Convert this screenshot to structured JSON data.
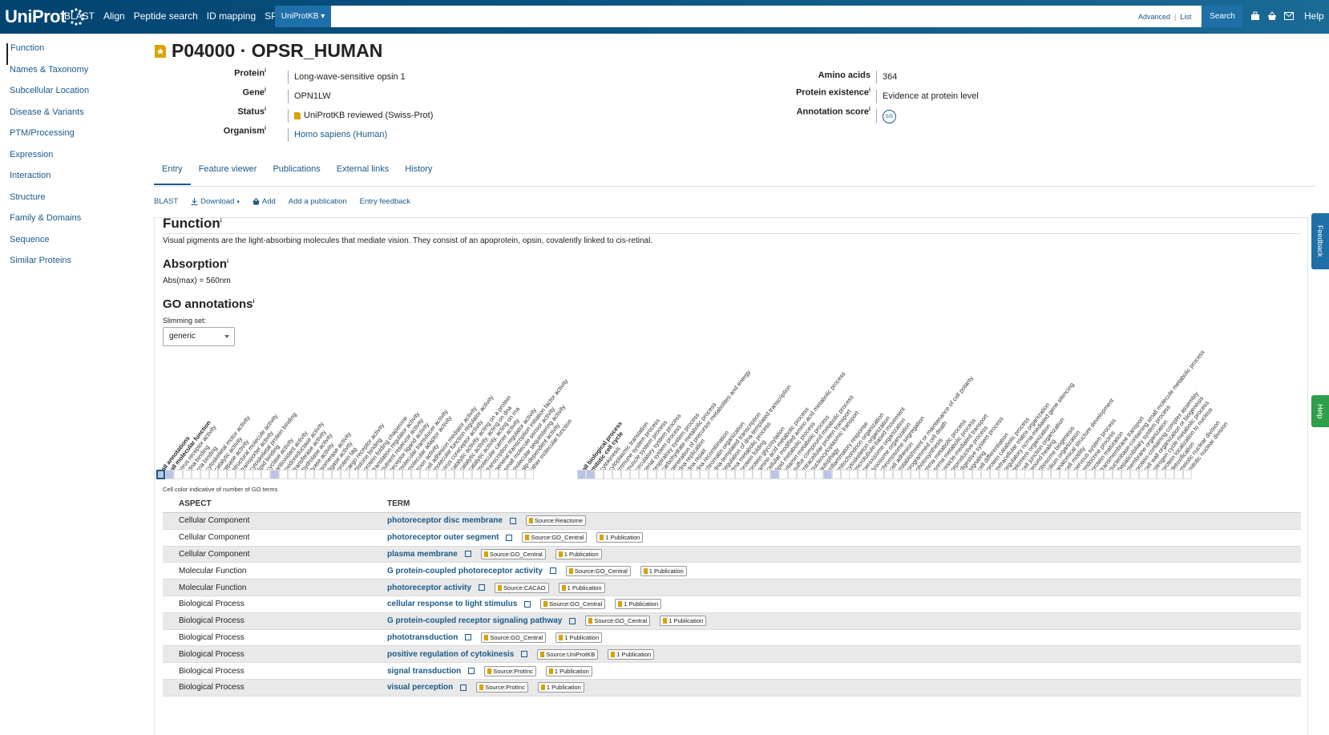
{
  "header": {
    "logo": "UniProt",
    "nav": [
      "BLAST",
      "Align",
      "Peptide search",
      "ID mapping",
      "SPARQL"
    ],
    "db_select": "UniProtKB",
    "search_placeholder": "",
    "advanced": "Advanced",
    "list": "List",
    "search_button": "Search",
    "help": "Help",
    "icons": [
      "tools-icon",
      "basket-icon",
      "mail-icon"
    ]
  },
  "sidebar": {
    "items": [
      "Function",
      "Names & Taxonomy",
      "Subcellular Location",
      "Disease & Variants",
      "PTM/Processing",
      "Expression",
      "Interaction",
      "Structure",
      "Family & Domains",
      "Sequence",
      "Similar Proteins"
    ],
    "active": "Function"
  },
  "entry": {
    "title": "P04000 · OPSR_HUMAN",
    "protein_label": "Protein",
    "protein": "Long-wave-sensitive opsin 1",
    "gene_label": "Gene",
    "gene": "OPN1LW",
    "status_label": "Status",
    "status": "UniProtKB reviewed (Swiss-Prot)",
    "organism_label": "Organism",
    "organism": "Homo sapiens (Human)",
    "amino_acids_label": "Amino acids",
    "amino_acids": "364",
    "existence_label": "Protein existence",
    "existence": "Evidence at protein level",
    "annotation_label": "Annotation score",
    "annotation_score": "5/5",
    "info_marker": "i"
  },
  "tabs": [
    "Entry",
    "Feature viewer",
    "Publications",
    "External links",
    "History"
  ],
  "actions": [
    "BLAST",
    "Download",
    "Add",
    "Add a publication",
    "Entry feedback"
  ],
  "function": {
    "heading": "Function",
    "text": "Visual pigments are the light-absorbing molecules that mediate vision. They consist of an apoprotein, opsin, covalently linked to cis-retinal.",
    "absorption_heading": "Absorption",
    "absorption": "Abs(max) = 560nm",
    "go_heading": "GO annotations",
    "slimming_label": "Slimming set:",
    "slimming_value": "generic",
    "legend": "Cell color indicative of number of GO terms"
  },
  "go_mf_terms": [
    "all annotations",
    "all molecular function",
    "virus receptor activity",
    "dna binding",
    "rna binding",
    "cytoskeletal motor activity",
    "catalytic activity",
    "gtpase activity",
    "structural molecule activity",
    "transporter activity",
    "cytoskeletal protein binding",
    "lipid binding",
    "cyclase activity",
    "antioxidant activity",
    "oxidoreductase activity",
    "transferase activity",
    "hydrolase activity",
    "lyase activity",
    "isomerase activity",
    "ligase activity",
    "protein tag",
    "cargo receptor activity",
    "histone binding",
    "protein folding chaperone",
    "translation regulator activity",
    "nutrient reservoir activity",
    "receptor ligand activity",
    "molecular transducer activity",
    "molecular adaptor activity",
    "toxin activity",
    "cell adhesion mediator activity",
    "molecular function regulator activity",
    "virus coreceptor activity",
    "catalytic activity, acting on a protein",
    "catalytic activity, acting on dna",
    "catalytic activity, acting on rna",
    "molecular carrier activity",
    "transcription regulator activity",
    "general transcription initiation factor activity",
    "small molecule sensor activity",
    "molecular sequestering activity",
    "atp-dependent activity",
    "other molecular function"
  ],
  "go_bp_terms": [
    "all biological process",
    "mitotic cell cycle",
    "cytokinesis",
    "cytoplasmic translation",
    "immune system process",
    "muscle system process",
    "circulatory system process",
    "renal system process",
    "respiratory system process",
    "carbohydrate metabolic process",
    "generation of precursor metabolites and energy",
    "dna replication",
    "dna repair",
    "dna recombination",
    "chromatin organization",
    "dna-templated transcription",
    "regulation of dna-templated transcription",
    "trna metabolic process",
    "protein folding",
    "protein glycosylation",
    "amino acid metabolic process",
    "cellular modified amino acid metabolic process",
    "lipid metabolic process",
    "vitamin metabolic process",
    "sulfur compound metabolic process",
    "intracellular protein transport",
    "nucleocytoplasmic transport",
    "autophagy",
    "inflammatory response",
    "mitochondrion organization",
    "cytoskeleton organization",
    "microtubule-based movement",
    "peroxisome organization",
    "lysosome organization",
    "chromosome segregation",
    "cell adhesion",
    "establishment or maintenance of cell polarity",
    "programmed cell death",
    "photosynthesis",
    "mrna metabolic process",
    "snrna metabolic process",
    "vesicle-mediated transport",
    "reproductive process",
    "digestive system process",
    "signaling",
    "cell differentiation",
    "protein catabolic process",
    "extracellular matrix organization",
    "regulatory ncrna-mediated gene silencing",
    "telomere organization",
    "cell junction organization",
    "wound healing",
    "ribosome biogenesis",
    "cilium organization",
    "anatomical structure development",
    "cell motility",
    "nervous system process",
    "endocrine process",
    "protein maturation",
    "transmembrane transport",
    "nucleobase-containing small molecule metabolic process",
    "hepaticobiliary system process",
    "membrane organization",
    "protein-containing complex assembly",
    "cell wall organization or biogenesis",
    "nitrogen cycle metabolic process",
    "protein localization to nucleus",
    "detoxification",
    "meiotic nuclear division",
    "mitotic nuclear division"
  ],
  "go_highlight_mf": [
    0,
    1,
    13
  ],
  "go_highlight_bp": [
    0,
    1,
    22,
    28
  ],
  "go_table": {
    "headers": [
      "ASPECT",
      "TERM"
    ],
    "rows": [
      {
        "aspect": "Cellular Component",
        "term": "photoreceptor disc membrane",
        "badges": [
          "Source:Reactome"
        ]
      },
      {
        "aspect": "Cellular Component",
        "term": "photoreceptor outer segment",
        "badges": [
          "Source:GO_Central",
          "1 Publication"
        ]
      },
      {
        "aspect": "Cellular Component",
        "term": "plasma membrane",
        "badges": [
          "Source:GO_Central",
          "1 Publication"
        ]
      },
      {
        "aspect": "Molecular Function",
        "term": "G protein-coupled photoreceptor activity",
        "badges": [
          "Source:GO_Central",
          "1 Publication"
        ]
      },
      {
        "aspect": "Molecular Function",
        "term": "photoreceptor activity",
        "badges": [
          "Source:CACAO",
          "1 Publication"
        ]
      },
      {
        "aspect": "Biological Process",
        "term": "cellular response to light stimulus",
        "badges": [
          "Source:GO_Central",
          "1 Publication"
        ]
      },
      {
        "aspect": "Biological Process",
        "term": "G protein-coupled receptor signaling pathway",
        "badges": [
          "Source:GO_Central",
          "1 Publication"
        ]
      },
      {
        "aspect": "Biological Process",
        "term": "phototransduction",
        "badges": [
          "Source:GO_Central",
          "1 Publication"
        ]
      },
      {
        "aspect": "Biological Process",
        "term": "positive regulation of cytokinesis",
        "badges": [
          "Source:UniProtKB",
          "1 Publication"
        ]
      },
      {
        "aspect": "Biological Process",
        "term": "signal transduction",
        "badges": [
          "Source:ProtInc",
          "1 Publication"
        ]
      },
      {
        "aspect": "Biological Process",
        "term": "visual perception",
        "badges": [
          "Source:ProtInc",
          "1 Publication"
        ]
      }
    ]
  },
  "side_tabs": {
    "feedback": "Feedback",
    "help": "Help"
  },
  "colors": {
    "brand": "#014371",
    "link": "#1a5a8a",
    "feedback": "#1f6fa8",
    "help": "#2e9e4a",
    "cell_filled": "#b9c4e6"
  }
}
